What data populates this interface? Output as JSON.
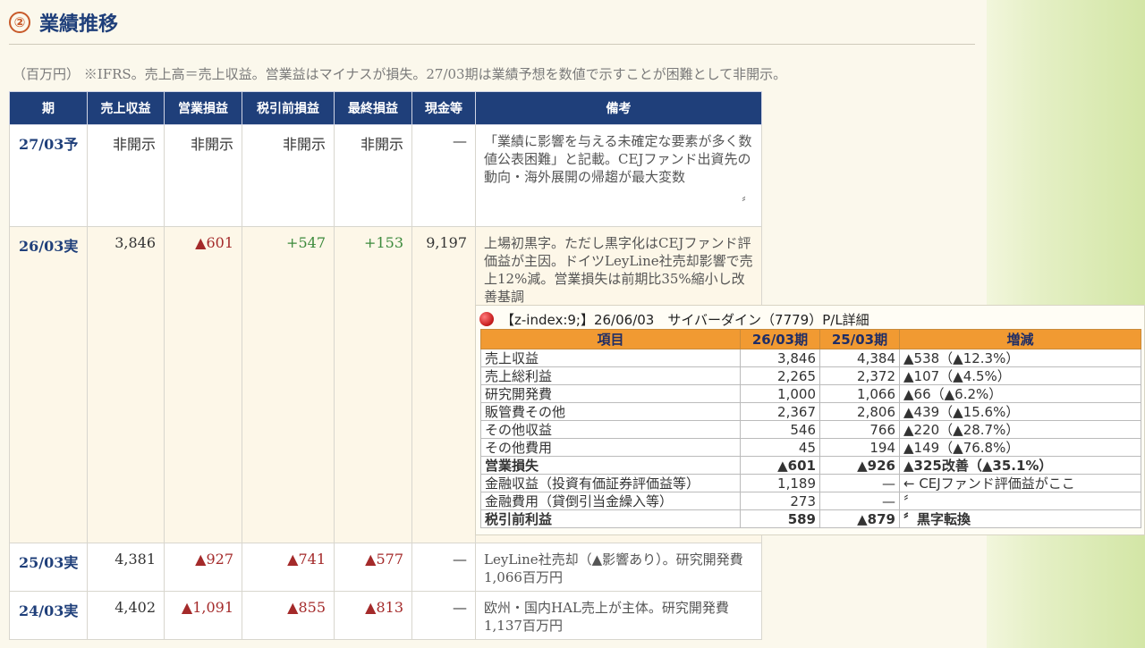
{
  "section": {
    "number": "②",
    "title": "業績推移"
  },
  "note": "（百万円） ※IFRS。売上高＝売上収益。営業益はマイナスが損失。27/03期は業績予想を数値で示すことが困難として非開示。",
  "table": {
    "headers": [
      "期",
      "売上収益",
      "営業損益",
      "税引前損益",
      "最終損益",
      "現金等",
      "備考"
    ],
    "rows": [
      {
        "period": "27/03予",
        "revenue": "非開示",
        "op": "非開示",
        "pretax": "非開示",
        "net": "非開示",
        "cash": "—",
        "remarks": "「業績に影響を与える未確定な要素が多く数値公表困難」と記載。CEJファンド出資先の動向・海外展開の帰趨が最大変数",
        "quote": "〞"
      },
      {
        "period": "26/03実",
        "revenue": "3,846",
        "op": "▲601",
        "pretax": "+547",
        "net": "+153",
        "cash": "9,197",
        "remarks": "上場初黒字。ただし黒字化はCEJファンド評価益が主因。ドイツLeyLine社売却影響で売上12%減。営業損失は前期比35%縮小し改善基調"
      },
      {
        "period": "25/03実",
        "revenue": "4,381",
        "op": "▲927",
        "pretax": "▲741",
        "net": "▲577",
        "cash": "—",
        "remarks": "LeyLine社売却（▲影響あり）。研究開発費1,066百万円"
      },
      {
        "period": "24/03実",
        "revenue": "4,402",
        "op": "▲1,091",
        "pretax": "▲855",
        "net": "▲813",
        "cash": "—",
        "remarks": "欧州・国内HAL売上が主体。研究開発費1,137百万円"
      }
    ]
  },
  "popup": {
    "title": "【z-index:9;】26/06/03　サイバーダイン（7779）P/L詳細",
    "headers": [
      "項目",
      "26/03期",
      "25/03期",
      "増減"
    ],
    "rows": [
      {
        "item": "売上収益",
        "cur": "3,846",
        "prev": "4,384",
        "diff": "▲538（▲12.3%）"
      },
      {
        "item": "売上総利益",
        "cur": "2,265",
        "prev": "2,372",
        "diff": "▲107（▲4.5%）"
      },
      {
        "item": "研究開発費",
        "cur": "1,000",
        "prev": "1,066",
        "diff": "▲66（▲6.2%）"
      },
      {
        "item": "販管費その他",
        "cur": "2,367",
        "prev": "2,806",
        "diff": "▲439（▲15.6%）"
      },
      {
        "item": "その他収益",
        "cur": "546",
        "prev": "766",
        "diff": "▲220（▲28.7%）"
      },
      {
        "item": "その他費用",
        "cur": "45",
        "prev": "194",
        "diff": "▲149（▲76.8%）"
      },
      {
        "item": "営業損失",
        "cur": "▲601",
        "prev": "▲926",
        "diff": "▲325改善（▲35.1%）"
      },
      {
        "item": "金融収益（投資有価証券評価益等）",
        "cur": "1,189",
        "prev": "—",
        "diff": "← CEJファンド評価益がここ"
      },
      {
        "item": "金融費用（貸倒引当金繰入等）",
        "cur": "273",
        "prev": "—",
        "diff": "〞"
      },
      {
        "item": "税引前利益",
        "cur": "589",
        "prev": "▲879",
        "diff": "〞黒字転換"
      }
    ]
  }
}
